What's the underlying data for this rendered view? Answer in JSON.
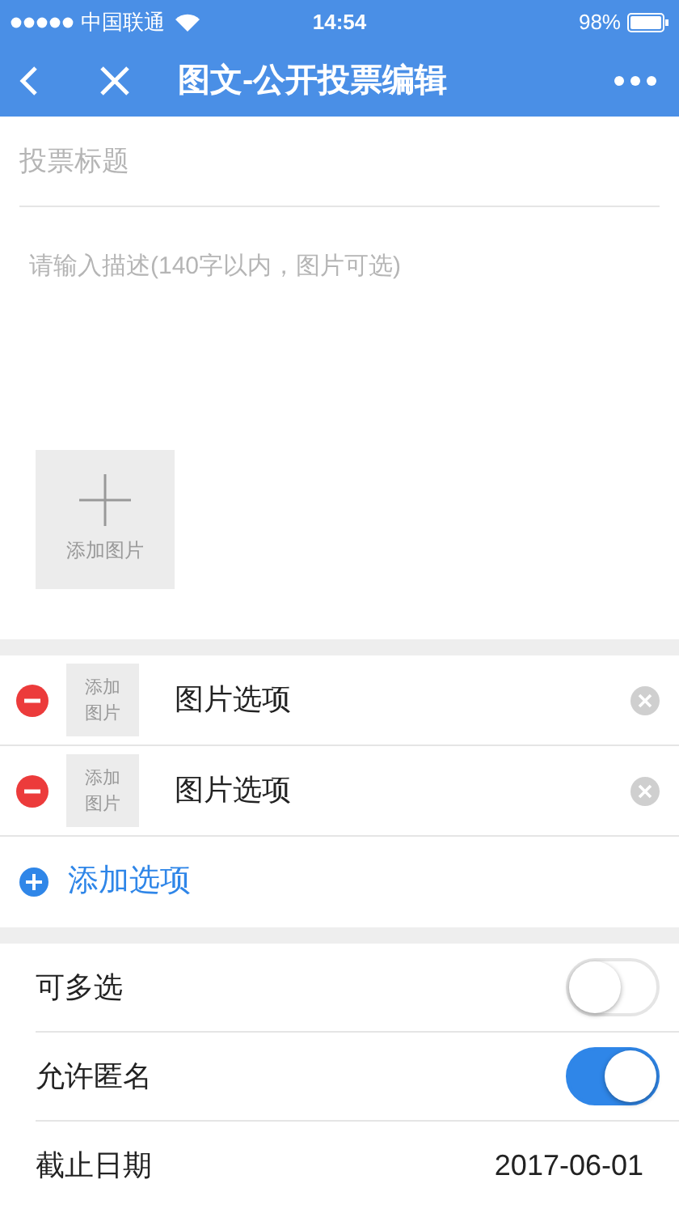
{
  "status_bar": {
    "carrier": "中国联通",
    "time": "14:54",
    "battery": "98%"
  },
  "nav": {
    "title": "图文-公开投票编辑"
  },
  "title_field": {
    "placeholder": "投票标题"
  },
  "description": {
    "placeholder": "请输入描述(140字以内，图片可选)"
  },
  "add_image": {
    "label": "添加图片"
  },
  "options": [
    {
      "thumb_label": "添加图片",
      "value": "图片选项"
    },
    {
      "thumb_label": "添加图片",
      "value": "图片选项"
    }
  ],
  "add_option": {
    "label": "添加选项"
  },
  "settings": [
    {
      "kind": "toggle",
      "label": "可多选",
      "on": false
    },
    {
      "kind": "toggle",
      "label": "允许匿名",
      "on": true
    },
    {
      "kind": "date",
      "label": "截止日期",
      "value": "2017-06-01"
    }
  ]
}
